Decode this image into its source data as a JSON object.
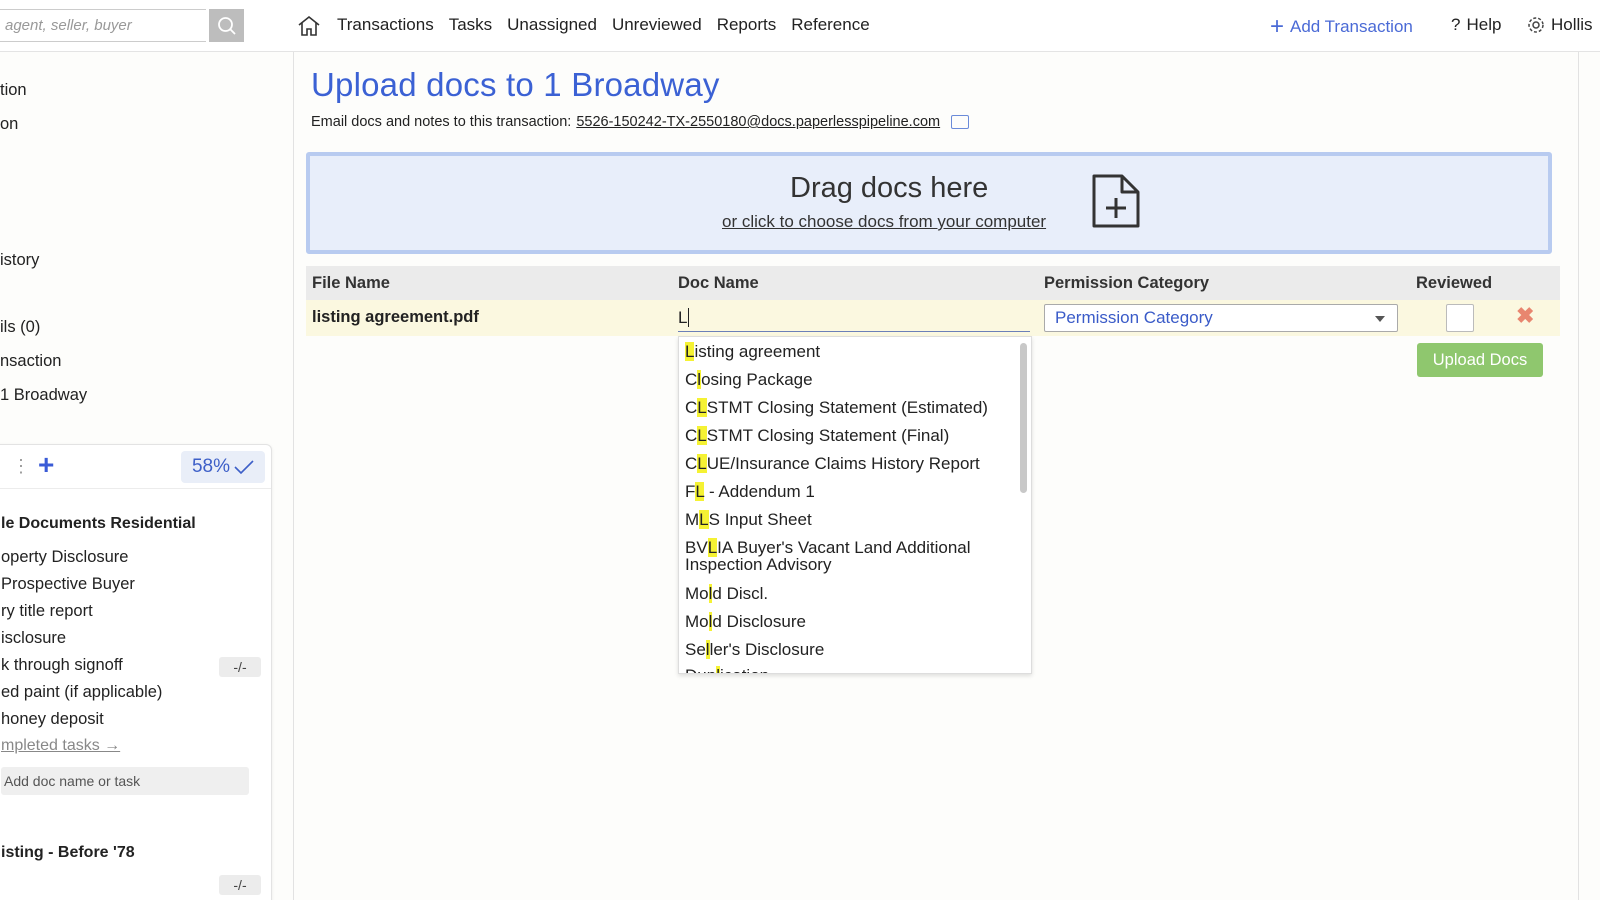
{
  "topbar": {
    "search_placeholder": "agent, seller, buyer",
    "nav": [
      "Transactions",
      "Tasks",
      "Unassigned",
      "Unreviewed",
      "Reports",
      "Reference"
    ],
    "add_transaction": "Add Transaction",
    "help": "Help",
    "user": "Hollis"
  },
  "sidebar": {
    "links": [
      "tion",
      "on",
      "istory",
      "ils (0)",
      "nsaction",
      "1 Broadway"
    ],
    "card": {
      "percent": "58%",
      "title1": "le Documents Residential",
      "tasks": [
        "operty Disclosure",
        "Prospective Buyer",
        "ry title report",
        "isclosure",
        "k through signoff",
        "ed paint (if applicable)",
        "honey deposit"
      ],
      "walk_badge": "-/-",
      "completed_link": "mpleted tasks →",
      "add_placeholder": "Add doc name or task",
      "title2": "isting - Before '78",
      "bottom_badge": "-/-"
    }
  },
  "main": {
    "title": "Upload docs to 1 Broadway",
    "email_label": "Email docs and notes to this transaction:",
    "email_address": "5526-150242-TX-2550180@docs.paperlesspipeline.com",
    "drop_title": "Drag docs here",
    "drop_link": "or click to choose docs from your computer",
    "columns": [
      "File Name",
      "Doc Name",
      "Permission Category",
      "Reviewed"
    ],
    "row": {
      "file_name": "listing agreement.pdf",
      "doc_name_value": "L",
      "permission_placeholder": "Permission Category"
    },
    "upload_button": "Upload Docs",
    "suggestions": [
      {
        "pre": "",
        "hl": "L",
        "post": "isting agreement"
      },
      {
        "pre": "C",
        "hl": "l",
        "post": "osing Package"
      },
      {
        "pre": "C",
        "hl": "L",
        "post": "STMT Closing Statement (Estimated)"
      },
      {
        "pre": "C",
        "hl": "L",
        "post": "STMT Closing Statement (Final)"
      },
      {
        "pre": "C",
        "hl": "L",
        "post": "UE/Insurance Claims History Report"
      },
      {
        "pre": "F",
        "hl": "L",
        "post": " - Addendum 1"
      },
      {
        "pre": "M",
        "hl": "L",
        "post": "S Input Sheet"
      },
      {
        "pre": "BV",
        "hl": "L",
        "post": "IA Buyer's Vacant Land Additional Inspection Advisory"
      },
      {
        "pre": "Mo",
        "hl": "l",
        "post": "d Discl."
      },
      {
        "pre": "Mo",
        "hl": "l",
        "post": "d Disclosure"
      },
      {
        "pre": "Se",
        "hl": "l",
        "post": "ler's Disclosure"
      },
      {
        "pre": "Dup",
        "hl": "l",
        "post": "ication"
      }
    ]
  }
}
